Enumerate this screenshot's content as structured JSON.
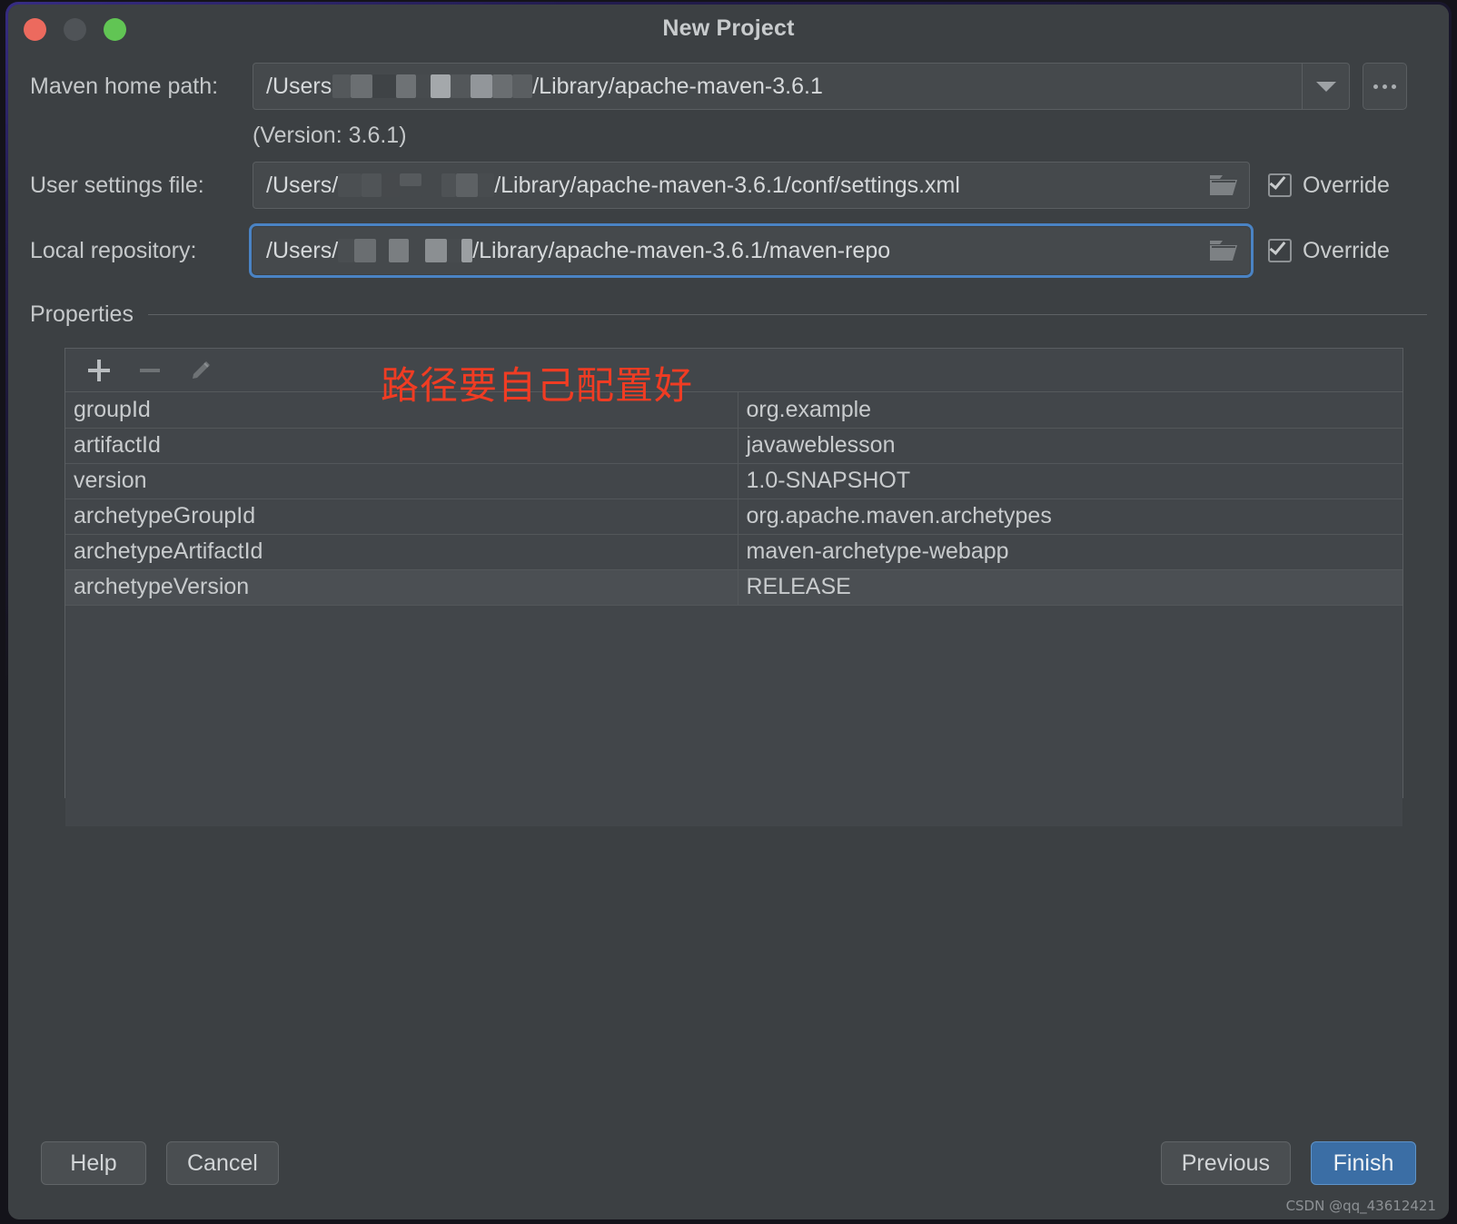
{
  "window": {
    "title": "New Project",
    "traffic_lights": [
      "close-red",
      "minimize-grey",
      "zoom-green"
    ]
  },
  "form": {
    "maven_home": {
      "label": "Maven home path:",
      "value_prefix": "/Users",
      "value_suffix": "/Library/apache-maven-3.6.1",
      "redacted": true,
      "dropdown_icon": "chevron-down-icon",
      "browse_label": "...",
      "version_note": "(Version: 3.6.1)"
    },
    "user_settings": {
      "label": "User settings file:",
      "value_prefix": "/Users/",
      "value_suffix": "/Library/apache-maven-3.6.1/conf/settings.xml",
      "redacted": true,
      "folder_icon": "folder-icon",
      "override_label": "Override",
      "override_checked": true
    },
    "local_repository": {
      "label": "Local repository:",
      "value_prefix": "/Users/",
      "value_suffix": "/Library/apache-maven-3.6.1/maven-repo",
      "redacted": true,
      "focused": true,
      "folder_icon": "folder-icon",
      "override_label": "Override",
      "override_checked": true
    }
  },
  "annotation": {
    "text": "路径要自己配置好",
    "color": "#f03c23"
  },
  "properties": {
    "section_title": "Properties",
    "toolbar": {
      "add_icon": "plus-icon",
      "remove_icon": "minus-icon",
      "edit_icon": "pencil-icon"
    },
    "rows": [
      {
        "name": "groupId",
        "value": "org.example",
        "selected": false
      },
      {
        "name": "artifactId",
        "value": "javaweblesson",
        "selected": false
      },
      {
        "name": "version",
        "value": "1.0-SNAPSHOT",
        "selected": false
      },
      {
        "name": "archetypeGroupId",
        "value": "org.apache.maven.archetypes",
        "selected": false
      },
      {
        "name": "archetypeArtifactId",
        "value": "maven-archetype-webapp",
        "selected": false
      },
      {
        "name": "archetypeVersion",
        "value": "RELEASE",
        "selected": true
      }
    ]
  },
  "footer": {
    "help_label": "Help",
    "cancel_label": "Cancel",
    "previous_label": "Previous",
    "finish_label": "Finish",
    "finish_accent_color": "#3b6ea5"
  },
  "watermark": "CSDN @qq_43612421"
}
